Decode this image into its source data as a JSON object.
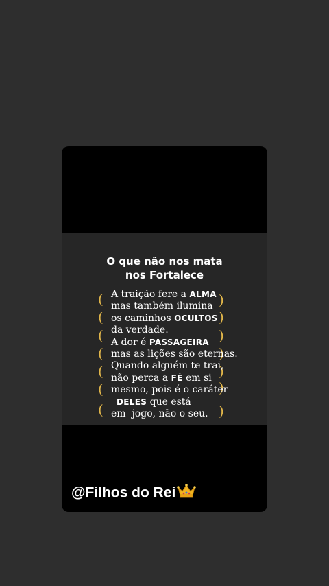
{
  "post": {
    "title_line1": "O que não nos mata",
    "title_line2": "nos Fortalece",
    "lines": [
      {
        "before": "A traição fere a ",
        "highlight": "ALMA",
        "after": ""
      },
      {
        "before": "mas também ilumina",
        "highlight": "",
        "after": ""
      },
      {
        "before": "os caminhos ",
        "highlight": "OCULTOS",
        "after": ""
      },
      {
        "before": "da verdade.",
        "highlight": "",
        "after": ""
      },
      {
        "before": "A dor é ",
        "highlight": "PASSAGEIRA",
        "after": ""
      },
      {
        "before": "mas as lições são eternas.",
        "highlight": "",
        "after": ""
      },
      {
        "before": "Quando alguém te trai,",
        "highlight": "",
        "after": ""
      },
      {
        "before": "não perca a ",
        "highlight": "FÉ",
        "after": " em si"
      },
      {
        "before": "mesmo, pois é o caráter",
        "highlight": "",
        "after": ""
      },
      {
        "before": " ",
        "highlight": "DELES",
        "after": " que está"
      },
      {
        "before": "em  jogo, não o seu.",
        "highlight": "",
        "after": ""
      }
    ],
    "left_paren": "(",
    "right_paren": ")",
    "accent_color": "#e1b64a"
  },
  "footer": {
    "handle": "@Filhos do Rei",
    "icon": "crown-icon"
  }
}
